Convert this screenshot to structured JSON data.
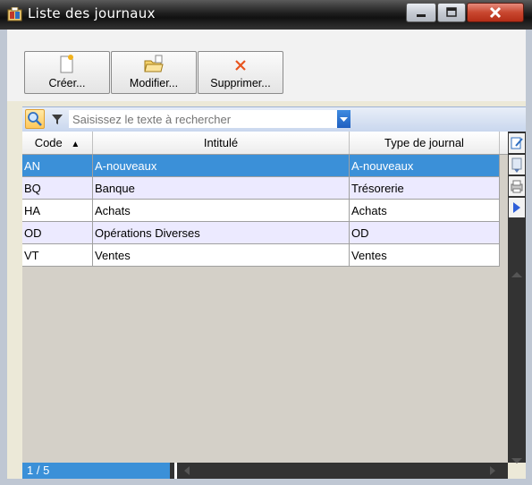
{
  "window": {
    "title": "Liste des journaux"
  },
  "toolbar": {
    "create_label": "Créer...",
    "edit_label": "Modifier...",
    "delete_label": "Supprimer..."
  },
  "search": {
    "placeholder": "Saisissez le texte à rechercher"
  },
  "table": {
    "columns": [
      "Code",
      "Intitulé",
      "Type de journal"
    ],
    "rows": [
      {
        "code": "AN",
        "label": "A-nouveaux",
        "type": "A-nouveaux"
      },
      {
        "code": "BQ",
        "label": "Banque",
        "type": "Trésorerie"
      },
      {
        "code": "HA",
        "label": "Achats",
        "type": "Achats"
      },
      {
        "code": "OD",
        "label": "Opérations Diverses",
        "type": "OD"
      },
      {
        "code": "VT",
        "label": "Ventes",
        "type": "Ventes"
      }
    ]
  },
  "status": {
    "count": "1 / 5"
  },
  "colors": {
    "selection": "#3b90d8",
    "titlebar": "#1e1e1e",
    "alt_row": "#eceaff"
  }
}
